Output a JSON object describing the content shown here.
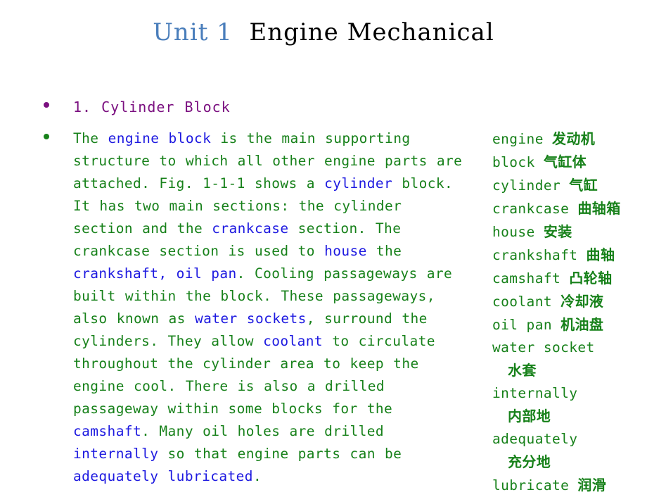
{
  "colors": {
    "title_accent": "#4A7EBB",
    "title_main": "#000000",
    "heading": "#7B1080",
    "body": "#17811A",
    "keyword": "#1D19E0",
    "background": "#FFFFFF"
  },
  "title": {
    "accent": "Unit 1",
    "spacer": "  ",
    "main": "Engine Mechanical",
    "full": "Unit 1  Engine Mechanical"
  },
  "heading": {
    "bullet": "•",
    "label": "1. Cylinder Block"
  },
  "paragraph": {
    "bullet": "•",
    "full_text": "The engine block is the main supporting structure to which all other engine parts are attached. Fig. 1-1-1 shows a cylinder block. It has two main sections: the cylinder section and the crankcase section. The crankcase section is used to house the crankshaft, oil pan. Cooling passageways are built within the block. These passageways, also known as water sockets, surround the cylinders. They allow coolant to circulate throughout the cylinder area to keep the engine cool. There is also a drilled passageway within some blocks for the camshaft. Many oil holes are drilled internally so that engine parts can be adequately lubricated.",
    "segments": [
      {
        "text": "The ",
        "keyword": false
      },
      {
        "text": "engine block",
        "keyword": true
      },
      {
        "text": " is the main supporting structure to which all other engine parts are attached. Fig. 1-1-1 shows a ",
        "keyword": false
      },
      {
        "text": "cylinder",
        "keyword": true
      },
      {
        "text": " block. It has two main sections: the cylinder section and the ",
        "keyword": false
      },
      {
        "text": "crankcase",
        "keyword": true
      },
      {
        "text": " section. The crankcase section is used to ",
        "keyword": false
      },
      {
        "text": "house",
        "keyword": true
      },
      {
        "text": " the ",
        "keyword": false
      },
      {
        "text": "crankshaft, oil pan",
        "keyword": true
      },
      {
        "text": ". Cooling passageways are built within the block. These passageways, also known as ",
        "keyword": false
      },
      {
        "text": "water sockets",
        "keyword": true
      },
      {
        "text": ", surround the cylinders. They allow ",
        "keyword": false
      },
      {
        "text": "coolant",
        "keyword": true
      },
      {
        "text": " to circulate throughout the cylinder area to keep the engine cool. There is also a drilled passageway within some blocks for the ",
        "keyword": false
      },
      {
        "text": "camshaft",
        "keyword": true
      },
      {
        "text": ". Many oil holes are drilled ",
        "keyword": false
      },
      {
        "text": "internally",
        "keyword": true
      },
      {
        "text": " so that engine parts can be ",
        "keyword": false
      },
      {
        "text": "adequately lubricated",
        "keyword": true
      },
      {
        "text": ".",
        "keyword": false
      }
    ],
    "lines": [
      "The engine block is the main supporting",
      "structure to which all other engine parts are",
      "attached. Fig. 1-1-1 shows a cylinder block.",
      "It has two main sections: the cylinder",
      "section and the crankcase section. The",
      "crankcase section is used to house the",
      "crankshaft, oil pan. Cooling passageways are",
      "built within the block. These passageways,",
      "also known as water sockets, surround the",
      "cylinders. They allow coolant to circulate",
      "throughout the cylinder area to keep the",
      "engine cool. There is also a drilled",
      "passageway within some blocks for the",
      "camshaft. Many oil holes are drilled",
      "internally so that engine parts can be",
      "adequately lubricated."
    ]
  },
  "vocabulary": {
    "entries": [
      {
        "term": "engine",
        "gloss": "发动机",
        "wrapped": false
      },
      {
        "term": "block",
        "gloss": "气缸体",
        "wrapped": false
      },
      {
        "term": "cylinder",
        "gloss": "气缸",
        "wrapped": false
      },
      {
        "term": "crankcase",
        "gloss": "曲轴箱",
        "wrapped": false
      },
      {
        "term": "house",
        "gloss": "安装",
        "wrapped": false
      },
      {
        "term": "crankshaft",
        "gloss": "曲轴",
        "wrapped": false
      },
      {
        "term": "camshaft",
        "gloss": "凸轮轴",
        "wrapped": false
      },
      {
        "term": "coolant",
        "gloss": "冷却液",
        "wrapped": false
      },
      {
        "term": "oil pan",
        "gloss": "机油盘",
        "wrapped": false
      },
      {
        "term": "water socket",
        "gloss": "水套",
        "wrapped": true
      },
      {
        "term": "internally",
        "gloss": "内部地",
        "wrapped": true
      },
      {
        "term": "adequately",
        "gloss": "充分地",
        "wrapped": true
      },
      {
        "term": "lubricate",
        "gloss": "润滑",
        "wrapped": false
      }
    ]
  }
}
